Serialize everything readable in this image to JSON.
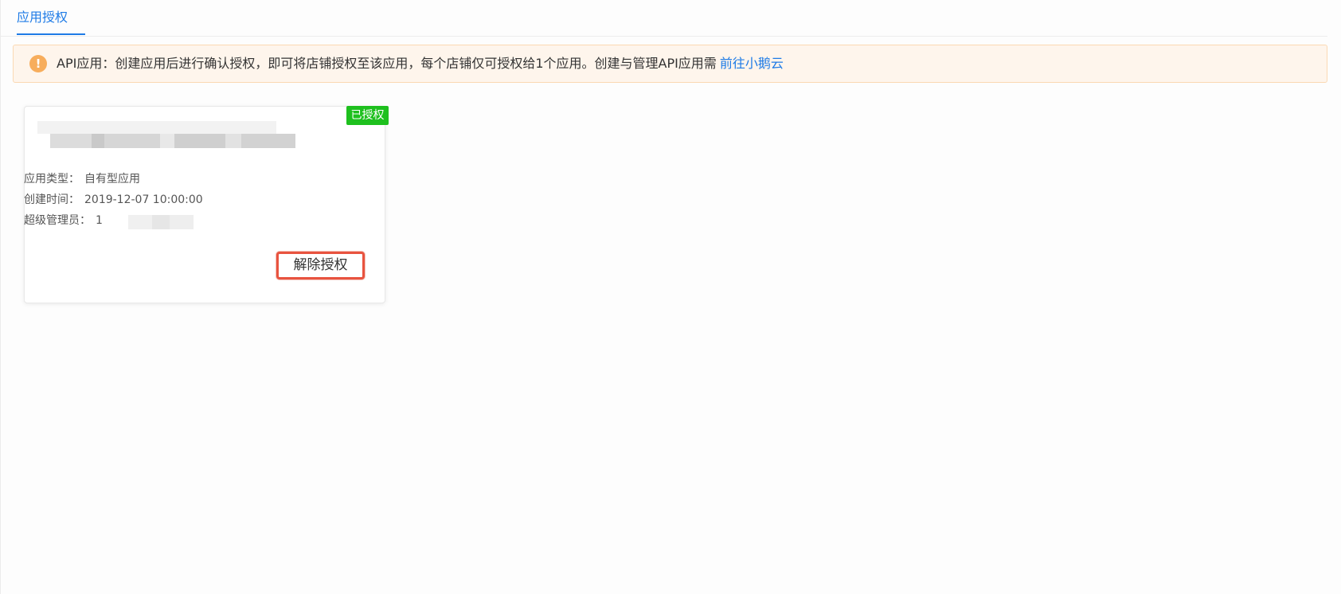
{
  "tabs": {
    "active_label": "应用授权"
  },
  "notice": {
    "text": "API应用：创建应用后进行确认授权，即可将店铺授权至该应用，每个店铺仅可授权给1个应用。创建与管理API应用需",
    "link_label": "前往小鹅云",
    "icon": "warning-icon"
  },
  "app_card": {
    "status": "已授权",
    "status_color": "#1ec01e",
    "fields": [
      {
        "label": "应用类型：",
        "value": "自有型应用"
      },
      {
        "label": "创建时间：",
        "value": "2019-12-07 10:00:00"
      },
      {
        "label": "超级管理员：",
        "value": "1"
      }
    ],
    "revoke_label": "解除授权"
  },
  "colors": {
    "accent": "#1e7be6",
    "warning": "#f7ad5c",
    "highlight": "#e8533f"
  }
}
